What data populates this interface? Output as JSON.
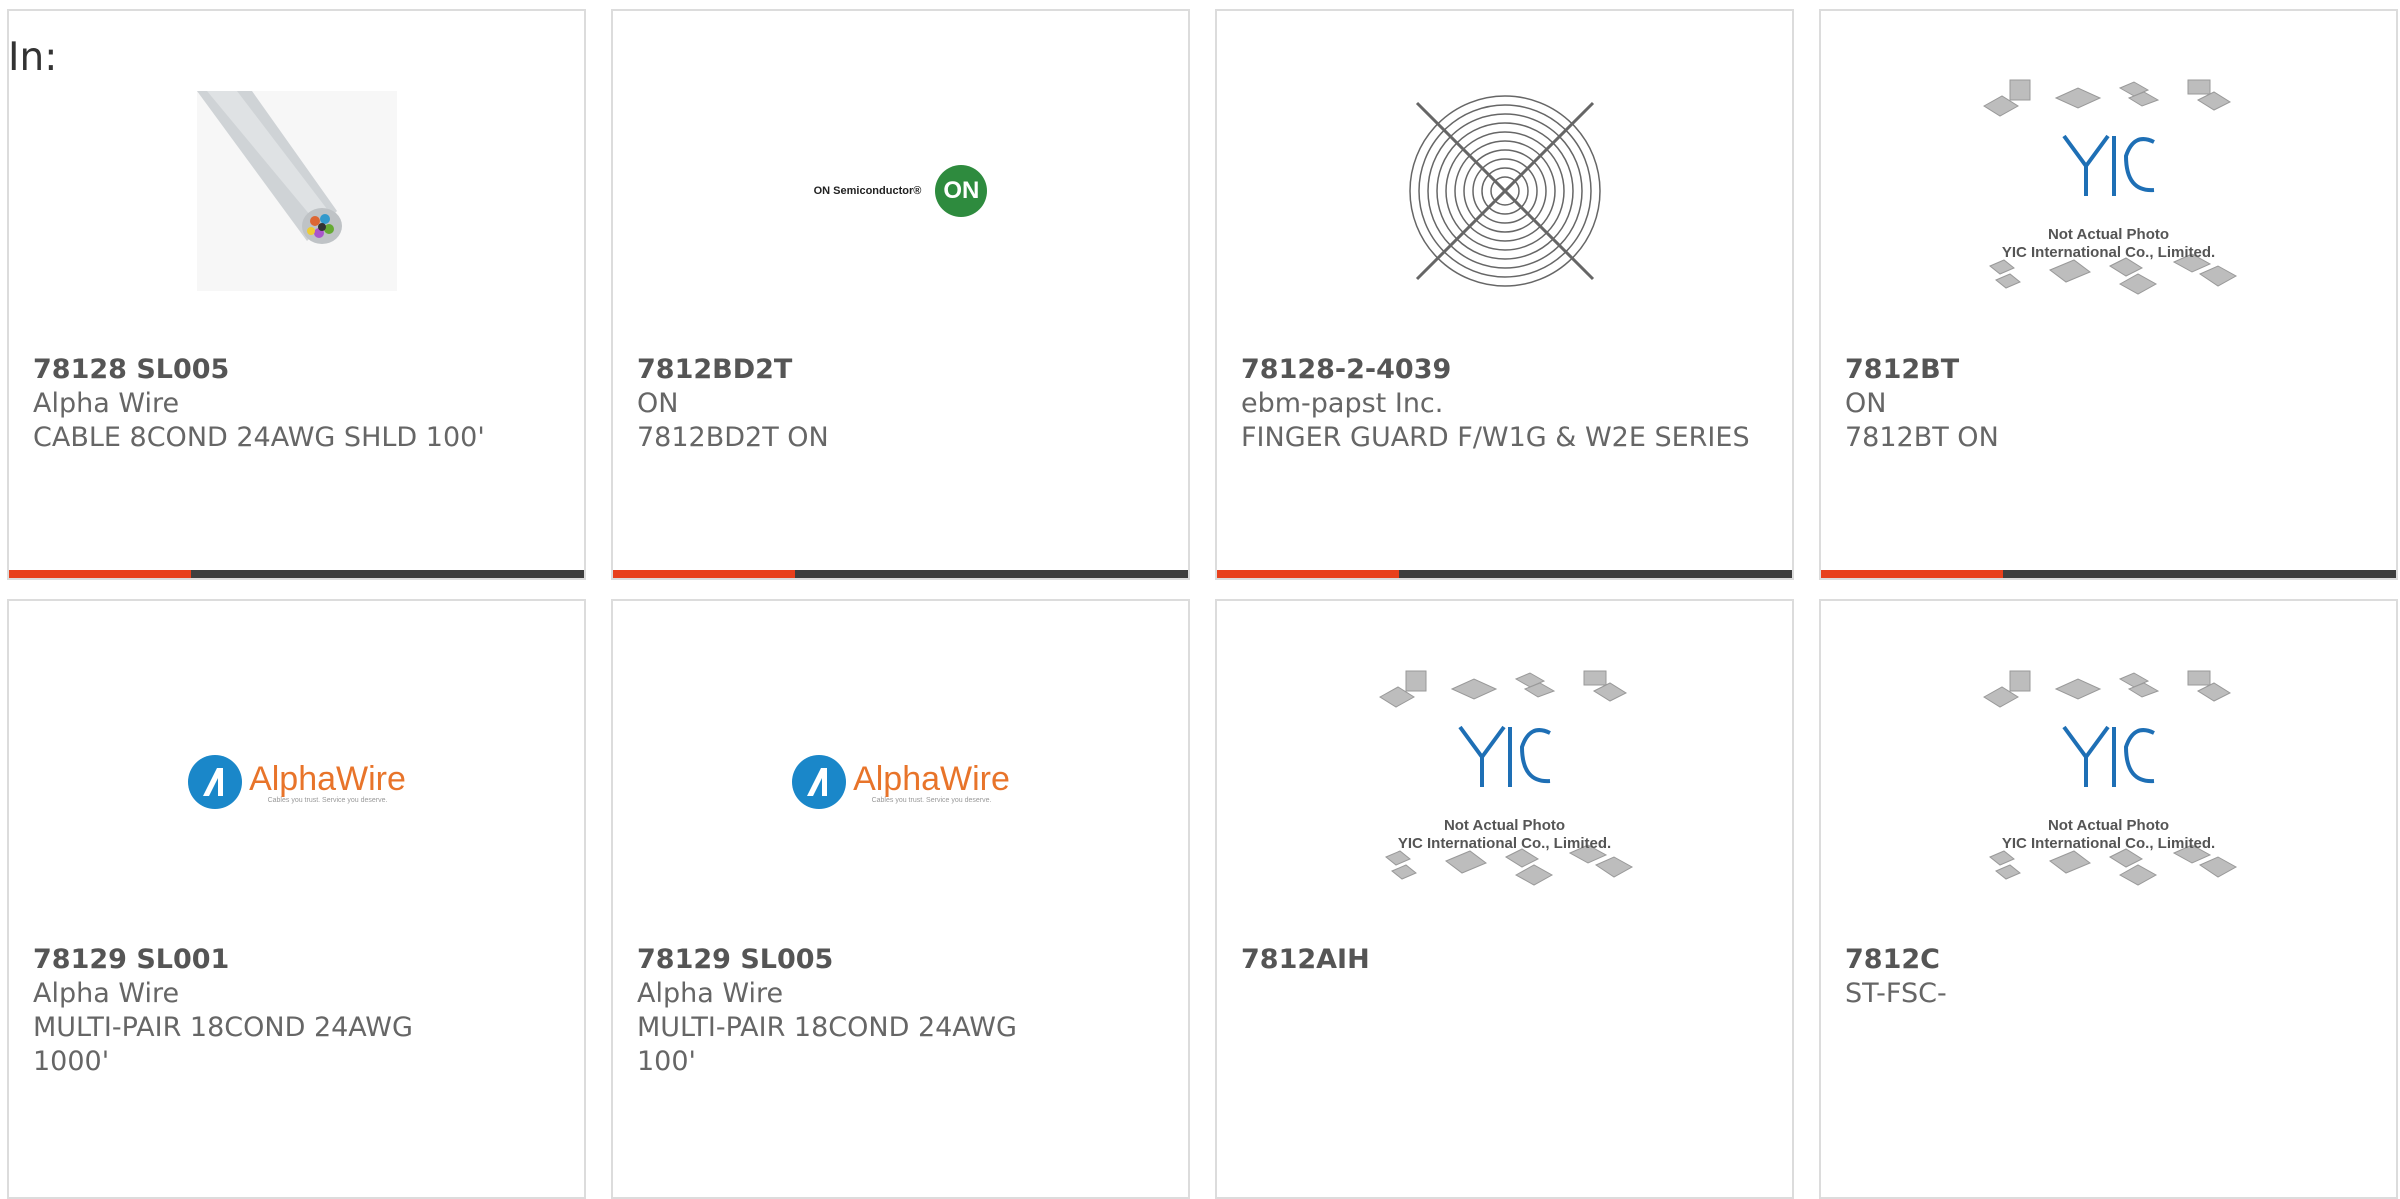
{
  "filter_label": "In:",
  "colors": {
    "accent": "#e8401c",
    "bar": "#3e3e3e",
    "border": "#dcdcdc",
    "text": "#666666"
  },
  "products": [
    {
      "part_number": "78128 SL005",
      "manufacturer": "Alpha Wire",
      "description": "CABLE 8COND 24AWG SHLD 100'",
      "image": "cable-photo"
    },
    {
      "part_number": "7812BD2T",
      "manufacturer": "ON",
      "description": "7812BD2T ON",
      "image": "on-semiconductor-logo",
      "logo_text": "ON Semiconductor®",
      "logo_badge": "ON"
    },
    {
      "part_number": "78128-2-4039",
      "manufacturer": "ebm-papst Inc.",
      "description": "FINGER GUARD F/W1G & W2E SERIES",
      "image": "fan-guard-photo"
    },
    {
      "part_number": "7812BT",
      "manufacturer": "ON",
      "description": "7812BT ON",
      "image": "yic-placeholder",
      "placeholder_line1": "Not Actual Photo",
      "placeholder_line2": "YIC International Co., Limited."
    },
    {
      "part_number": "78129 SL001",
      "manufacturer": "Alpha Wire",
      "description": "MULTI-PAIR 18COND 24AWG 1000'",
      "image": "alphawire-logo",
      "logo_text": "AlphaWire",
      "logo_tagline": "Cables you trust. Service you deserve."
    },
    {
      "part_number": "78129 SL005",
      "manufacturer": "Alpha Wire",
      "description": "MULTI-PAIR 18COND 24AWG 100'",
      "image": "alphawire-logo",
      "logo_text": "AlphaWire",
      "logo_tagline": "Cables you trust. Service you deserve."
    },
    {
      "part_number": "7812AIH",
      "manufacturer": "",
      "description": "",
      "image": "yic-placeholder",
      "placeholder_line1": "Not Actual Photo",
      "placeholder_line2": "YIC International Co., Limited."
    },
    {
      "part_number": "7812C",
      "manufacturer": "ST-FSC-",
      "description": "",
      "image": "yic-placeholder",
      "placeholder_line1": "Not Actual Photo",
      "placeholder_line2": "YIC International Co., Limited."
    }
  ]
}
